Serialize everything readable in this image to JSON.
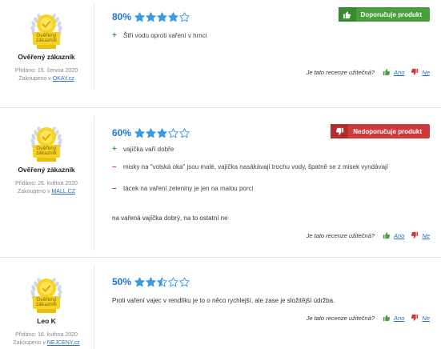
{
  "colors": {
    "accent": "#2176d2",
    "positive": "#47a03c",
    "negative": "#d0393a",
    "star_fill": "#3b9ae1",
    "badge_gold": "#f7d324"
  },
  "reviews": [
    {
      "badge_text_1": "Ověřený",
      "badge_text_2": "zákazník",
      "author": "Ověřený zákazník",
      "added": "Přidáno: 15. června 2020",
      "bought_prefix": "Zakoupeno v",
      "shop": "OKAY.cz",
      "percent": "80%",
      "rating": 4,
      "recommend": {
        "type": "positive",
        "label": "Doporučuje produkt",
        "icon": "thumbs-up-icon"
      },
      "pros": [
        "Štří vodu oproti vaření v hrnci"
      ],
      "cons": [],
      "text": "",
      "helpful": {
        "question": "Je tato recenze užitečná?",
        "yes": "Ano",
        "no": "Ne"
      }
    },
    {
      "badge_text_1": "Ověřený",
      "badge_text_2": "zákazník",
      "author": "Ověřený zákazník",
      "added": "Přidáno: 26. května 2020",
      "bought_prefix": "Zakoupeno v",
      "shop": "MALL.CZ",
      "percent": "60%",
      "rating": 3,
      "recommend": {
        "type": "negative",
        "label": "Nedoporučuje produkt",
        "icon": "thumbs-down-icon"
      },
      "pros": [
        "vajíčka vaří dobře"
      ],
      "cons": [
        "misky na \"volská oka\" jsou malé, vajíčka nasákávají trochu vody, špatně se z misek vyndávají",
        "tácek na vaření zeleniny je jen na malou porci"
      ],
      "text": "na vařená vajíčka dobrý, na to ostatní ne",
      "helpful": {
        "question": "Je tato recenze užitečná?",
        "yes": "Ano",
        "no": "Ne"
      }
    },
    {
      "badge_text_1": "Ověřený",
      "badge_text_2": "zákazník",
      "author": "Leo K",
      "added": "Přidáno: 16. května 2020",
      "bought_prefix": "Zakoupeno v",
      "shop": "NEJCENY.cz",
      "percent": "50%",
      "rating": 2.5,
      "recommend": null,
      "pros": [],
      "cons": [],
      "text": "Proti vaření vajec v rendlíku je to o něco rychlejší, ale zase je složitější údržba.",
      "helpful": {
        "question": "Je tato recenze užitečná?",
        "yes": "Ano",
        "no": "Ne"
      }
    }
  ]
}
